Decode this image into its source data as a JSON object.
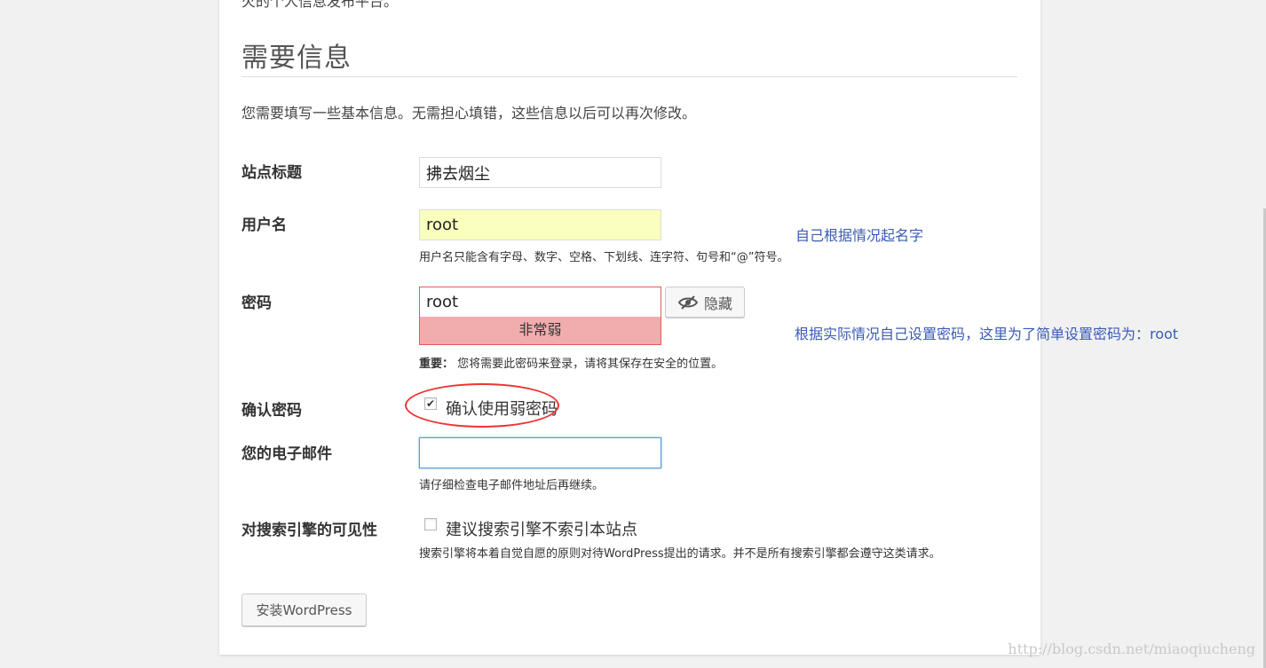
{
  "header": {
    "prev_text": "火的个人信息发布平台。",
    "title": "需要信息",
    "intro": "您需要填写一些基本信息。无需担心填错，这些信息以后可以再次修改。"
  },
  "form": {
    "site_title": {
      "label": "站点标题",
      "value": "拂去烟尘"
    },
    "username": {
      "label": "用户名",
      "value": "root",
      "hint": "用户名只能含有字母、数字、空格、下划线、连字符、句号和“@”符号。"
    },
    "password": {
      "label": "密码",
      "value": "root",
      "strength": "非常弱",
      "hide_button": "隐藏",
      "hint_strong": "重要：",
      "hint": "您将需要此密码来登录，请将其保存在安全的位置。"
    },
    "confirm": {
      "label": "确认密码",
      "checkbox_label": "确认使用弱密码",
      "checked": true
    },
    "email": {
      "label": "您的电子邮件",
      "value": "",
      "hint": "请仔细检查电子邮件地址后再继续。"
    },
    "search": {
      "label": "对搜索引擎的可见性",
      "checkbox_label": "建议搜索引擎不索引本站点",
      "checked": false,
      "hint": "搜索引擎将本着自觉自愿的原则对待WordPress提出的请求。并不是所有搜索引擎都会遵守这类请求。"
    },
    "install_button": "安装WordPress"
  },
  "annotations": {
    "username_note": "自己根据情况起名字",
    "password_note": "根据实际情况自己设置密码，这里为了简单设置密码为：root"
  },
  "watermark": "http://blog.csdn.net/miaoqiucheng",
  "colors": {
    "weak_bg": "#f1adad",
    "weak_border": "#e35b5b",
    "autofill_bg": "#faffbd",
    "annotation": "#3a5bb5",
    "highlight_oval": "#e33333"
  },
  "icons": {
    "hide": "eye-slash-icon",
    "check": "checkmark-icon"
  }
}
